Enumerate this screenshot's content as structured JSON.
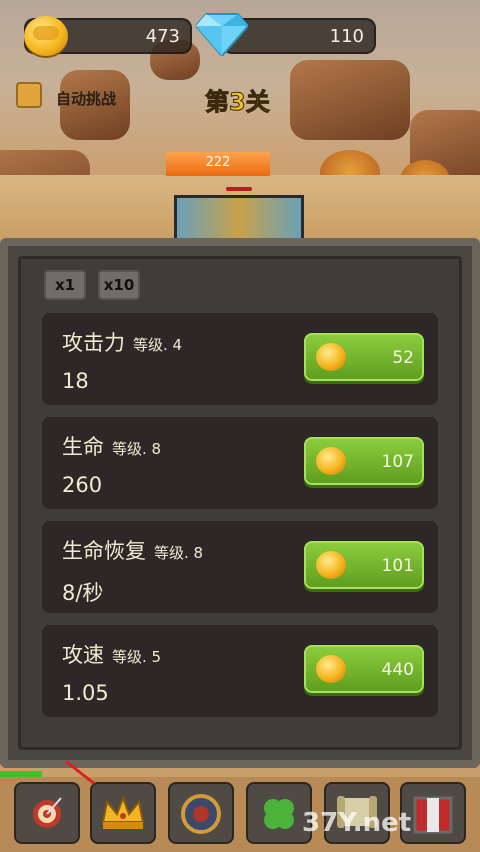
{
  "hud": {
    "coins": "473",
    "diamonds": "110"
  },
  "auto_challenge_label": "自动挑战",
  "stage_title": "第3关",
  "enemy_hp": "222",
  "multipliers": [
    "x1",
    "x10"
  ],
  "stats": [
    {
      "name": "攻击力",
      "level": "等级. 4",
      "value": "18",
      "cost": "52"
    },
    {
      "name": "生命",
      "level": "等级. 8",
      "value": "260",
      "cost": "107"
    },
    {
      "name": "生命恢复",
      "level": "等级. 8",
      "value": "8/秒",
      "cost": "101"
    },
    {
      "name": "攻速",
      "level": "等级. 5",
      "value": "1.05",
      "cost": "440"
    }
  ],
  "bottom_tabs": [
    {
      "icon": "target-icon"
    },
    {
      "icon": "crown-icon"
    },
    {
      "icon": "shield-icon"
    },
    {
      "icon": "clover-icon"
    },
    {
      "icon": "scroll-icon"
    },
    {
      "icon": "chest-icon"
    }
  ],
  "watermark": "37Y.net",
  "colors": {
    "accent": "#f2c12a",
    "button_green": "#7ab832",
    "panel": "#3f3c39"
  }
}
